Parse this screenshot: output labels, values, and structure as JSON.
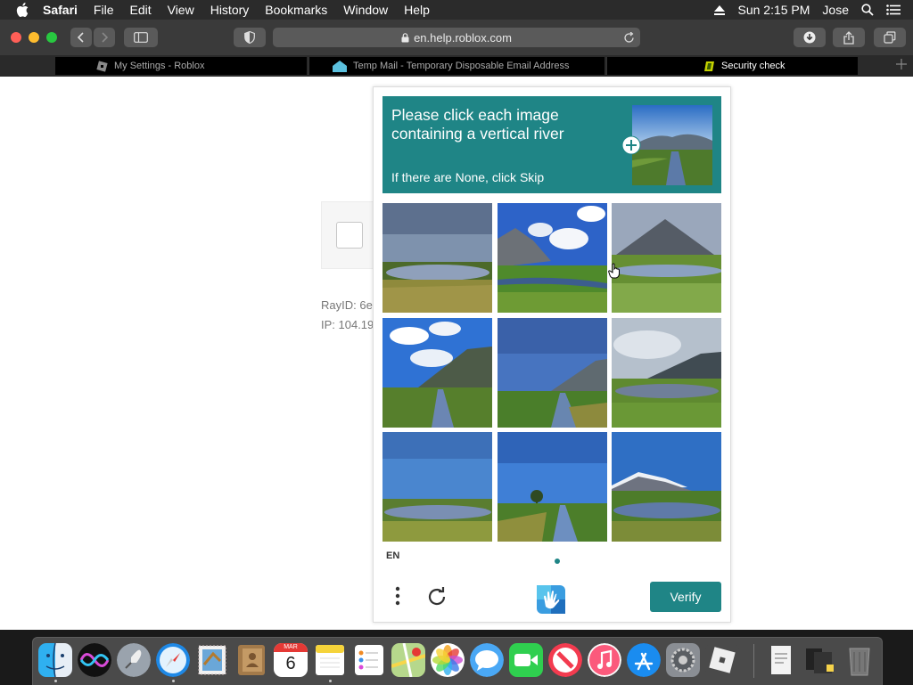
{
  "menubar": {
    "app": "Safari",
    "items": [
      "File",
      "Edit",
      "View",
      "History",
      "Bookmarks",
      "Window",
      "Help"
    ],
    "clock": "Sun 2:15 PM",
    "user": "Jose"
  },
  "toolbar": {
    "url": "en.help.roblox.com"
  },
  "tabs": [
    {
      "title": "My Settings - Roblox",
      "active": false
    },
    {
      "title": "Temp Mail - Temporary Disposable Email Address",
      "active": false
    },
    {
      "title": "Security check",
      "active": true
    }
  ],
  "background_page": {
    "ray_id": "RayID: 6e",
    "ip": "IP: 104.19"
  },
  "captcha": {
    "prompt_title": "Please click each image containing a vertical river",
    "prompt_hint": "If there are None, click Skip",
    "language": "EN",
    "verify_label": "Verify",
    "accent_color": "#1f8586",
    "tiles": [
      {
        "id": 1,
        "desc": "lake horizontal"
      },
      {
        "id": 2,
        "desc": "mountain clouds horizontal river"
      },
      {
        "id": 3,
        "desc": "volcano horizontal river"
      },
      {
        "id": 4,
        "desc": "clouds mountain vertical river"
      },
      {
        "id": 5,
        "desc": "mountain vertical river"
      },
      {
        "id": 6,
        "desc": "cloudy mountain horizontal river"
      },
      {
        "id": 7,
        "desc": "blue sky horizontal lake"
      },
      {
        "id": 8,
        "desc": "tree vertical river"
      },
      {
        "id": 9,
        "desc": "snowy mountain horizontal lake"
      }
    ]
  },
  "dock": {
    "apps": [
      "Finder",
      "Siri",
      "Launchpad",
      "Safari",
      "Mail",
      "Contacts",
      "Calendar",
      "Notes",
      "Reminders",
      "Maps",
      "Photos",
      "Messages",
      "FaceTime",
      "News",
      "Music",
      "App Store",
      "System Preferences",
      "Roblox"
    ],
    "calendar_month": "MAR",
    "calendar_day": "6"
  }
}
